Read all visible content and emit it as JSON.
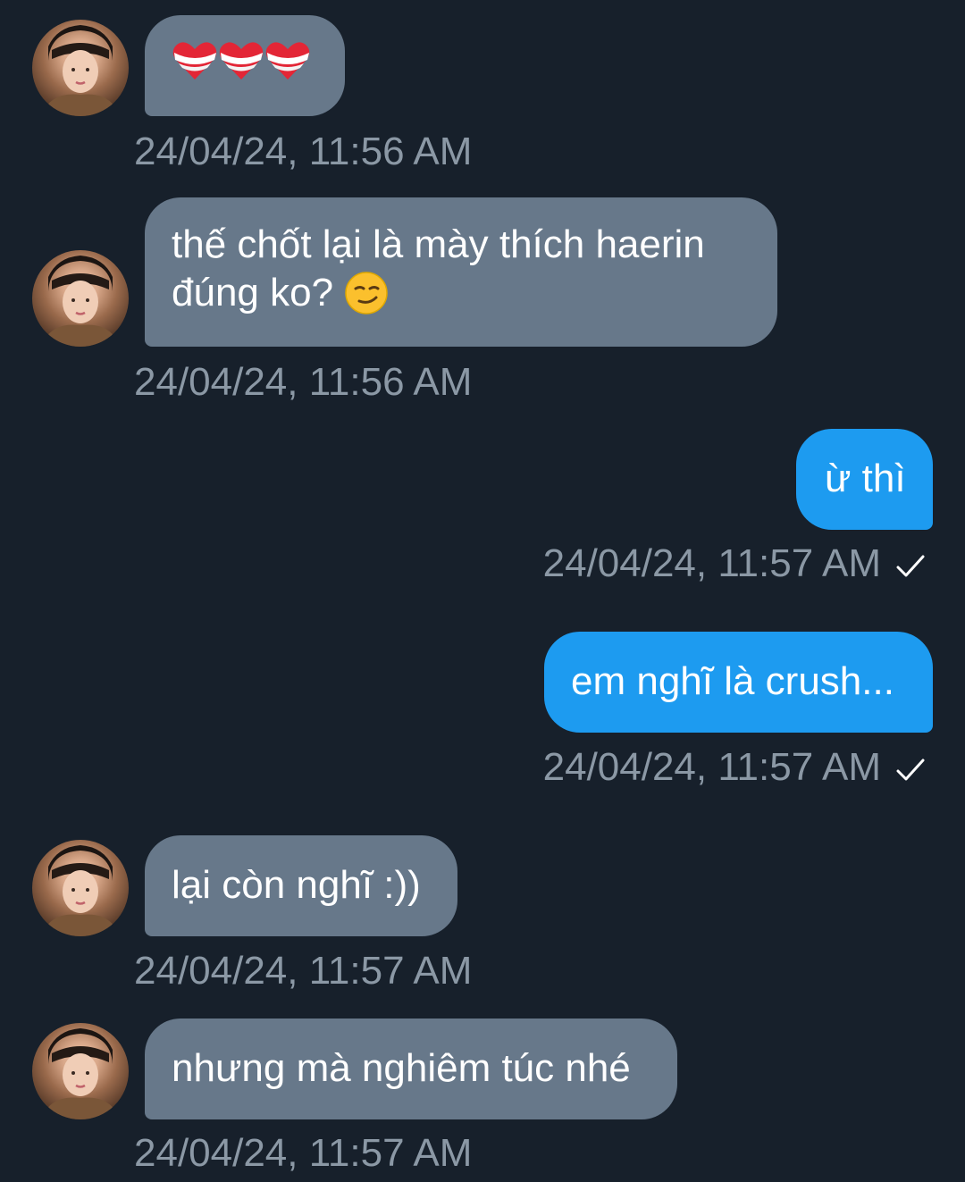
{
  "messages": [
    {
      "side": "in",
      "text": "",
      "emojis": [
        "heart-bandaged",
        "heart-bandaged",
        "heart-bandaged"
      ],
      "time": "24/04/24, 11:56 AM"
    },
    {
      "side": "in",
      "lines": [
        "thế chốt lại là mày thích haerin",
        "đúng ko?"
      ],
      "emoji": "smirking-face",
      "time": "24/04/24, 11:56 AM"
    },
    {
      "side": "out",
      "text": "ừ thì",
      "time": "24/04/24, 11:57 AM",
      "status": "sent-check"
    },
    {
      "side": "out",
      "text": "em nghĩ là crush...",
      "time": "24/04/24, 11:57 AM",
      "status": "sent-check"
    },
    {
      "side": "in",
      "text": "lại còn nghĩ :))",
      "time": "24/04/24, 11:57 AM"
    },
    {
      "side": "in",
      "text": "nhưng mà nghiêm túc nhé",
      "time": "24/04/24, 11:57 AM"
    }
  ],
  "colors": {
    "background": "#17202b",
    "incoming_bubble": "#67788a",
    "outgoing_bubble": "#1d9bf0",
    "timestamp": "#8b98a5"
  }
}
